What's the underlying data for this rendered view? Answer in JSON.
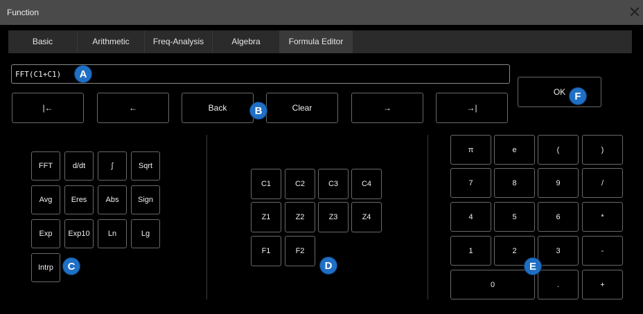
{
  "window": {
    "title": "Function",
    "close_icon": "close-icon"
  },
  "tabs": [
    {
      "label": "Basic",
      "active": false
    },
    {
      "label": "Arithmetic",
      "active": false
    },
    {
      "label": "Freq-Analysis",
      "active": false
    },
    {
      "label": "Algebra",
      "active": false
    },
    {
      "label": "Formula Editor",
      "active": true
    }
  ],
  "formula": {
    "value": "FFT(C1+C1)"
  },
  "nav_buttons": [
    {
      "label": "|←",
      "icon": "jump-to-start-icon"
    },
    {
      "label": "←",
      "icon": "arrow-left-icon"
    },
    {
      "label": "Back"
    },
    {
      "label": "Clear"
    },
    {
      "label": "→",
      "icon": "arrow-right-icon"
    },
    {
      "label": "→|",
      "icon": "jump-to-end-icon"
    }
  ],
  "ok_button": {
    "label": "OK"
  },
  "function_keys": [
    [
      "FFT",
      "d/dt",
      "∫",
      "Sqrt"
    ],
    [
      "Avg",
      "Eres",
      "Abs",
      "Sign"
    ],
    [
      "Exp",
      "Exp10",
      "Ln",
      "Lg"
    ],
    [
      "Intrp"
    ]
  ],
  "channel_keys": [
    [
      "C1",
      "C2",
      "C3",
      "C4"
    ],
    [
      "Z1",
      "Z2",
      "Z3",
      "Z4"
    ],
    [
      "F1",
      "F2"
    ]
  ],
  "numeric_keys": [
    [
      "π",
      "e",
      "(",
      ")"
    ],
    [
      "7",
      "8",
      "9",
      "/"
    ],
    [
      "4",
      "5",
      "6",
      "*"
    ],
    [
      "1",
      "2",
      "3",
      "-"
    ],
    [
      "0",
      ".",
      "+"
    ]
  ],
  "callouts": {
    "a": "A",
    "b": "B",
    "c": "C",
    "d": "D",
    "e": "E",
    "f": "F"
  },
  "colors": {
    "callout": "#1f6fc4",
    "titlebar": "#4a4a4a",
    "tab_active": "#3a3a3a"
  }
}
